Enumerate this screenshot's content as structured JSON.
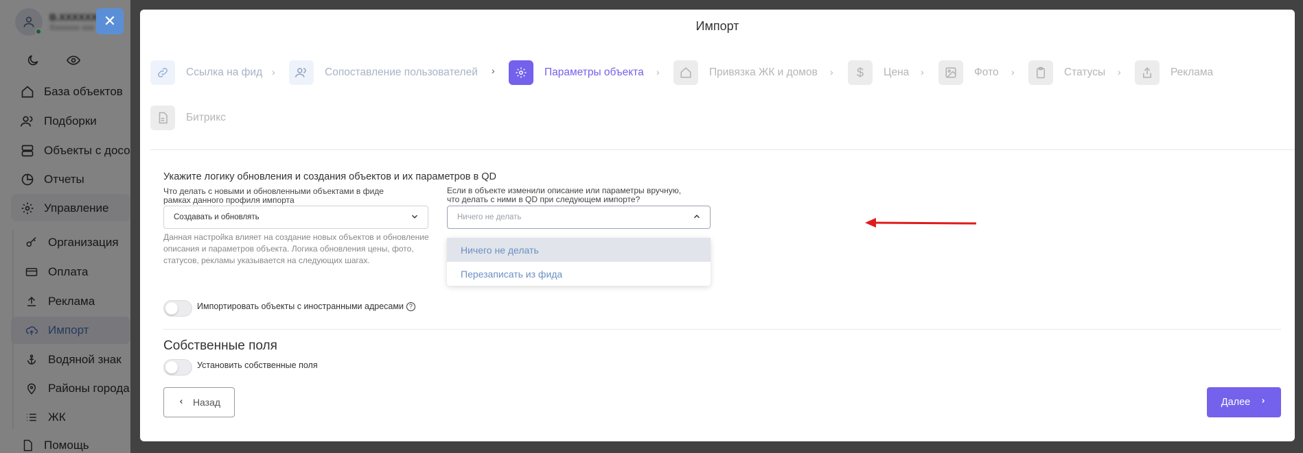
{
  "sidebar": {
    "user_name": "B.XXXXXX",
    "user_role": "Xxxxxxx xxx",
    "items": [
      {
        "label": "База объектов",
        "icon": "home-icon"
      },
      {
        "label": "Подборки",
        "icon": "users-icon"
      },
      {
        "label": "Объекты с досо",
        "icon": "server-icon"
      },
      {
        "label": "Отчеты",
        "icon": "pie-chart-icon"
      },
      {
        "label": "Управление",
        "icon": "gear-icon"
      }
    ],
    "sub_items": [
      {
        "label": "Организация",
        "icon": "key-icon"
      },
      {
        "label": "Оплата",
        "icon": "card-icon"
      },
      {
        "label": "Реклама",
        "icon": "upload-icon"
      },
      {
        "label": "Импорт",
        "icon": "cloud-upload-icon"
      },
      {
        "label": "Водяной знак",
        "icon": "anchor-icon"
      },
      {
        "label": "Районы города",
        "icon": "pin-icon"
      },
      {
        "label": "ЖК",
        "icon": "list-icon"
      }
    ],
    "help": {
      "label": "Помощь",
      "icon": "doc-icon"
    }
  },
  "modal": {
    "title": "Импорт",
    "steps": [
      {
        "label": "Ссылка на фид",
        "state": "done",
        "icon": "link-icon"
      },
      {
        "label": "Сопоставление пользователей",
        "state": "done",
        "icon": "users-icon"
      },
      {
        "label": "Параметры объекта",
        "state": "active",
        "icon": "gear-icon"
      },
      {
        "label": "Привязка ЖК и домов",
        "state": "todo",
        "icon": "home-icon"
      },
      {
        "label": "Цена",
        "state": "todo",
        "icon": "dollar-icon"
      },
      {
        "label": "Фото",
        "state": "todo",
        "icon": "image-icon"
      },
      {
        "label": "Статусы",
        "state": "todo",
        "icon": "clipboard-icon"
      },
      {
        "label": "Реклама",
        "state": "todo",
        "icon": "share-icon"
      },
      {
        "label": "Битрикс",
        "state": "todo",
        "icon": "file-icon"
      }
    ],
    "section_heading": "Укажите логику обновления и создания объектов и их параметров в QD",
    "field1": {
      "label_line1": "Что делать с новыми и обновленными объектами в фиде",
      "label_line2": "рамках данного профиля импорта",
      "value": "Создавать и обновлять"
    },
    "field2": {
      "label_line1": "Если в объекте изменили описание или параметры вручную,",
      "label_line2": "что делать с ними в QD при следующем импорте?",
      "value": "Ничего не делать",
      "options": [
        "Ничего не делать",
        "Перезаписать из фида"
      ]
    },
    "hint": "Данная настройка влияет на создание новых объектов и обновление описания и параметров объекта. Логика обновления цены, фото, статусов, рекламы указывается на следующих шагах.",
    "foreign_toggle_label": "Импортировать объекты с иностранными адресами",
    "own_fields_title": "Собственные поля",
    "own_fields_toggle_label": "Установить собственные поля",
    "back_label": "Назад",
    "next_label": "Далее"
  },
  "colors": {
    "accent": "#7461ec",
    "arrow": "#e01b1b",
    "close_button": "#5a8fd8"
  }
}
